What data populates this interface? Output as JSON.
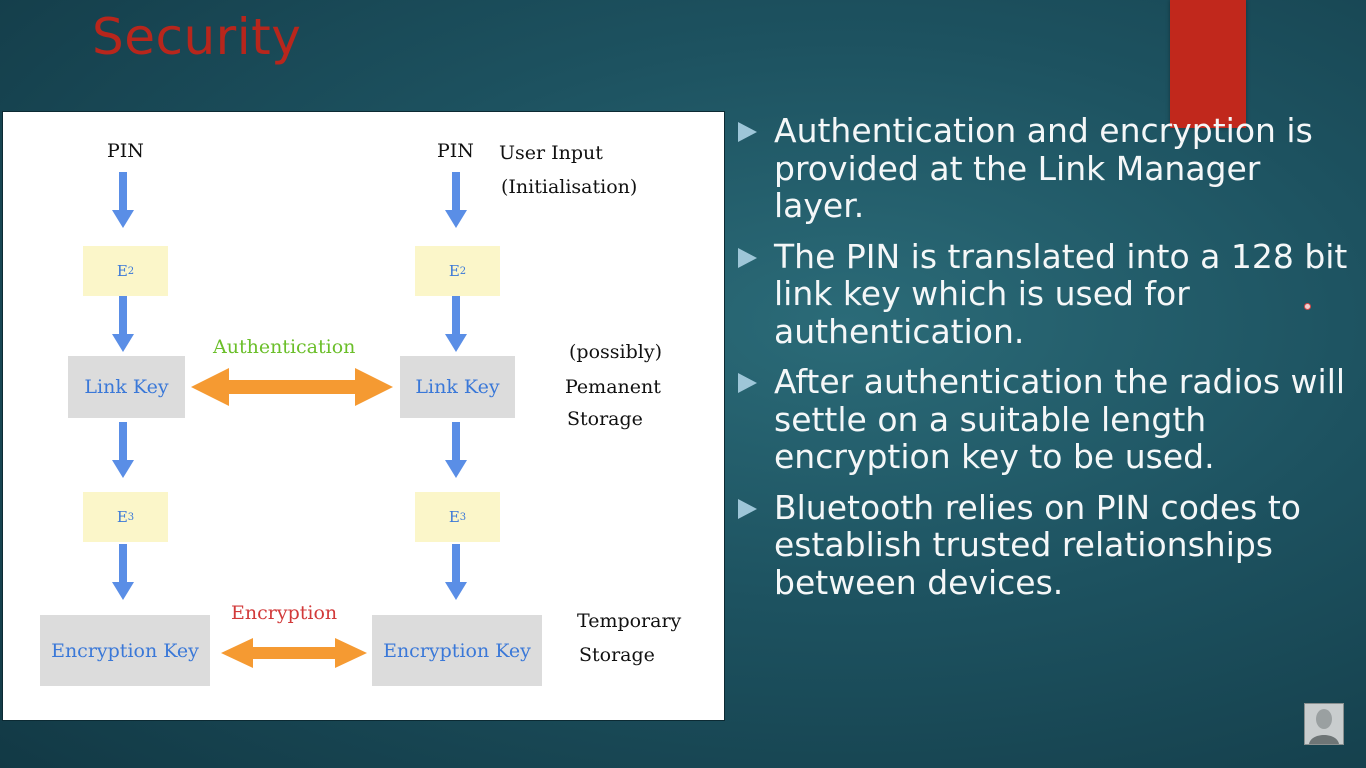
{
  "slide": {
    "title": "Security"
  },
  "diagram": {
    "left": {
      "pin_label": "PIN",
      "e2_label": "E",
      "e2_sub": "2",
      "link_key_label": "Link Key",
      "e3_label": "E",
      "e3_sub": "3",
      "encryption_key_label": "Encryption Key"
    },
    "right": {
      "pin_label": "PIN",
      "e2_label": "E",
      "e2_sub": "2",
      "link_key_label": "Link Key",
      "e3_label": "E",
      "e3_sub": "3",
      "encryption_key_label": "Encryption Key"
    },
    "user_input_label": "User Input",
    "initialisation_label": "(Initialisation)",
    "authentication_label": "Authentication",
    "encryption_label": "Encryption",
    "permanent_storage": [
      "(possibly)",
      "Pemanent",
      "Storage"
    ],
    "temporary_storage": [
      "Temporary",
      "Storage"
    ],
    "colors": {
      "arrow_blue": "#5a8ee6",
      "arrow_orange": "#f59a32",
      "authentication_text": "#6bbf2a",
      "encryption_text": "#d23a3a",
      "key_text": "#3a78d8",
      "e_box": "#fbf6c9",
      "key_box": "#dcdcdc"
    }
  },
  "bullets": [
    "Authentication and encryption is provided at the Link Manager layer.",
    "The PIN is translated into a 128 bit link key which is used for authentication.",
    "After authentication the radios will settle on a suitable length encryption key to be used.",
    "Bluetooth relies on PIN codes to establish trusted relationships between devices."
  ],
  "colors": {
    "title": "#b8261c",
    "accent_block": "#c1281c",
    "bullet_text": "#f4f7f8",
    "bullet_marker": "#9ec6d8"
  }
}
